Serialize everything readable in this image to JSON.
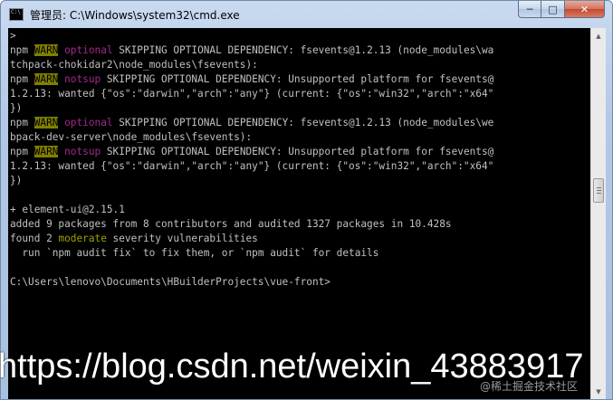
{
  "window": {
    "title": "管理员: C:\\Windows\\system32\\cmd.exe",
    "icon": "cmd-icon",
    "buttons": {
      "minimize": "minimize-icon",
      "maximize": "maximize-icon",
      "close": "close-icon"
    }
  },
  "console": {
    "colors": {
      "warn_bg": "#808000",
      "yellow": "#a0a000",
      "magenta": "#a02a8a",
      "text": "#c0c0c0",
      "background": "#000000"
    },
    "lines": [
      {
        "segments": [
          {
            "text": ">",
            "style": "plain"
          }
        ]
      },
      {
        "segments": [
          {
            "text": "npm ",
            "style": "plain"
          },
          {
            "text": "WARN",
            "style": "warn"
          },
          {
            "text": " ",
            "style": "plain"
          },
          {
            "text": "optional",
            "style": "magenta"
          },
          {
            "text": " SKIPPING OPTIONAL DEPENDENCY: fsevents@1.2.13 (node_modules\\wa",
            "style": "plain"
          }
        ]
      },
      {
        "segments": [
          {
            "text": "tchpack-chokidar2\\node_modules\\fsevents):",
            "style": "plain"
          }
        ]
      },
      {
        "segments": [
          {
            "text": "npm ",
            "style": "plain"
          },
          {
            "text": "WARN",
            "style": "warn"
          },
          {
            "text": " ",
            "style": "plain"
          },
          {
            "text": "notsup",
            "style": "magenta"
          },
          {
            "text": " SKIPPING OPTIONAL DEPENDENCY: Unsupported platform for fsevents@",
            "style": "plain"
          }
        ]
      },
      {
        "segments": [
          {
            "text": "1.2.13: wanted {\"os\":\"darwin\",\"arch\":\"any\"} (current: {\"os\":\"win32\",\"arch\":\"x64\"",
            "style": "plain"
          }
        ]
      },
      {
        "segments": [
          {
            "text": "})",
            "style": "plain"
          }
        ]
      },
      {
        "segments": [
          {
            "text": "npm ",
            "style": "plain"
          },
          {
            "text": "WARN",
            "style": "warn"
          },
          {
            "text": " ",
            "style": "plain"
          },
          {
            "text": "optional",
            "style": "magenta"
          },
          {
            "text": " SKIPPING OPTIONAL DEPENDENCY: fsevents@1.2.13 (node_modules\\we",
            "style": "plain"
          }
        ]
      },
      {
        "segments": [
          {
            "text": "bpack-dev-server\\node_modules\\fsevents):",
            "style": "plain"
          }
        ]
      },
      {
        "segments": [
          {
            "text": "npm ",
            "style": "plain"
          },
          {
            "text": "WARN",
            "style": "warn"
          },
          {
            "text": " ",
            "style": "plain"
          },
          {
            "text": "notsup",
            "style": "magenta"
          },
          {
            "text": " SKIPPING OPTIONAL DEPENDENCY: Unsupported platform for fsevents@",
            "style": "plain"
          }
        ]
      },
      {
        "segments": [
          {
            "text": "1.2.13: wanted {\"os\":\"darwin\",\"arch\":\"any\"} (current: {\"os\":\"win32\",\"arch\":\"x64\"",
            "style": "plain"
          }
        ]
      },
      {
        "segments": [
          {
            "text": "})",
            "style": "plain"
          }
        ]
      },
      {
        "segments": [
          {
            "text": "",
            "style": "plain"
          }
        ]
      },
      {
        "segments": [
          {
            "text": "+ element-ui@2.15.1",
            "style": "plain"
          }
        ]
      },
      {
        "segments": [
          {
            "text": "added 9 packages from 8 contributors and audited 1327 packages in 10.428s",
            "style": "plain"
          }
        ]
      },
      {
        "segments": [
          {
            "text": "found 2 ",
            "style": "plain"
          },
          {
            "text": "moderate",
            "style": "yellow"
          },
          {
            "text": " severity vulnerabilities",
            "style": "plain"
          }
        ]
      },
      {
        "segments": [
          {
            "text": "  run `npm audit fix` to fix them, or `npm audit` for details",
            "style": "plain"
          }
        ]
      },
      {
        "segments": [
          {
            "text": "",
            "style": "plain"
          }
        ]
      },
      {
        "segments": [
          {
            "text": "C:\\Users\\lenovo\\Documents\\HBuilderProjects\\vue-front>",
            "style": "plain"
          }
        ]
      }
    ]
  },
  "scrollbar": {
    "up_icon": "scroll-up-arrow-icon",
    "down_icon": "scroll-down-arrow-icon"
  },
  "watermark": {
    "url": "https://blog.csdn.net/weixin_43883917",
    "credit": "@稀土掘金技术社区"
  }
}
